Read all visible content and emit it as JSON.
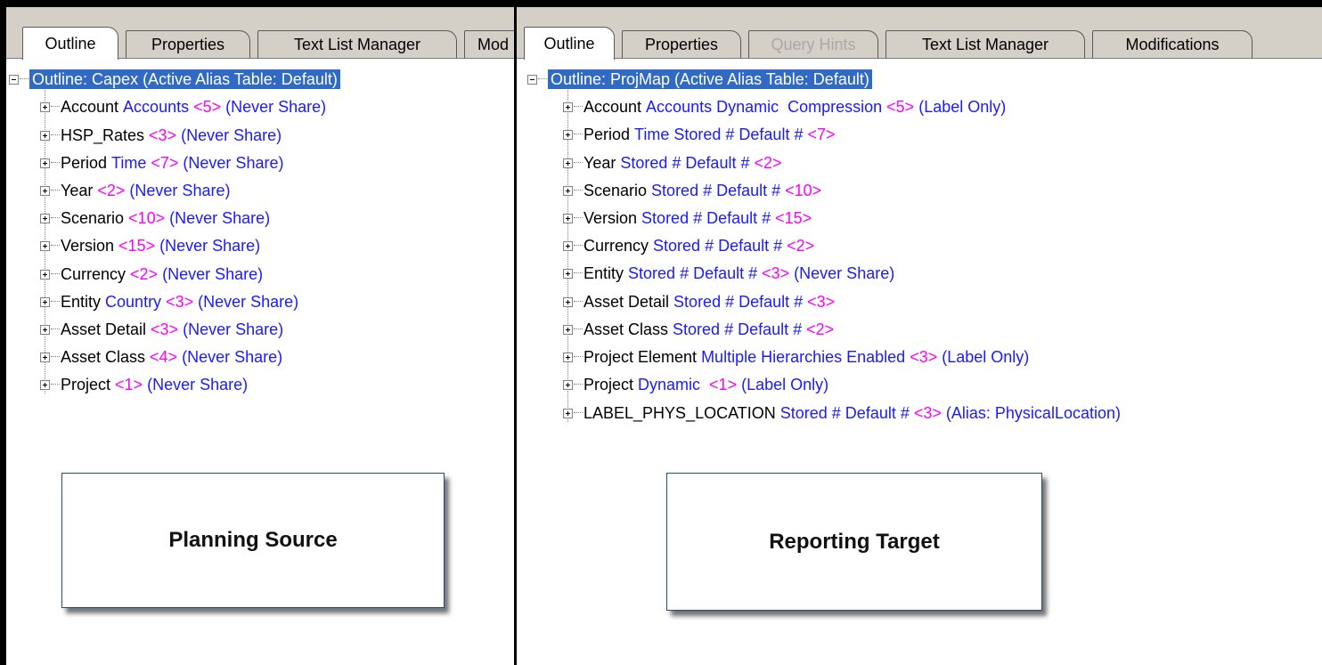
{
  "left_panel": {
    "tabs": [
      {
        "label": "Outline",
        "active": true
      },
      {
        "label": "Properties"
      },
      {
        "label": "Text List Manager"
      },
      {
        "label": "Mod"
      }
    ],
    "root": {
      "label": "Outline: Capex (Active Alias Table: Default)",
      "expander": "minus"
    },
    "members": [
      {
        "name": "Account",
        "blue": "Accounts",
        "pink": "<5>",
        "tail": "(Never Share)"
      },
      {
        "name": "HSP_Rates",
        "blue": "",
        "pink": "<3>",
        "tail": "(Never Share)"
      },
      {
        "name": "Period",
        "blue": "Time",
        "pink": "<7>",
        "tail": "(Never Share)"
      },
      {
        "name": "Year",
        "blue": "",
        "pink": "<2>",
        "tail": "(Never Share)"
      },
      {
        "name": "Scenario",
        "blue": "",
        "pink": "<10>",
        "tail": "(Never Share)"
      },
      {
        "name": "Version",
        "blue": "",
        "pink": "<15>",
        "tail": "(Never Share)"
      },
      {
        "name": "Currency",
        "blue": "",
        "pink": "<2>",
        "tail": "(Never Share)"
      },
      {
        "name": "Entity",
        "blue": "Country",
        "pink": "<3>",
        "tail": "(Never Share)"
      },
      {
        "name": "Asset Detail",
        "blue": "",
        "pink": "<3>",
        "tail": "(Never Share)"
      },
      {
        "name": "Asset Class",
        "blue": "",
        "pink": "<4>",
        "tail": "(Never Share)"
      },
      {
        "name": "Project",
        "blue": "",
        "pink": "<1>",
        "tail": "(Never Share)"
      }
    ],
    "callout": "Planning Source"
  },
  "right_panel": {
    "tabs": [
      {
        "label": "Outline",
        "active": true
      },
      {
        "label": "Properties"
      },
      {
        "label": "Query Hints",
        "disabled": true
      },
      {
        "label": "Text List Manager"
      },
      {
        "label": "Modifications"
      }
    ],
    "root": {
      "label": "Outline: ProjMap (Active Alias Table: Default)",
      "expander": "minus"
    },
    "members": [
      {
        "name": "Account",
        "blue": "Accounts Dynamic  Compression",
        "pink": "<5>",
        "tail": "(Label Only)"
      },
      {
        "name": "Period",
        "blue": "Time Stored # Default #",
        "pink": "<7>",
        "tail": ""
      },
      {
        "name": "Year",
        "blue": "Stored # Default #",
        "pink": "<2>",
        "tail": ""
      },
      {
        "name": "Scenario",
        "blue": "Stored # Default #",
        "pink": "<10>",
        "tail": ""
      },
      {
        "name": "Version",
        "blue": "Stored # Default #",
        "pink": "<15>",
        "tail": ""
      },
      {
        "name": "Currency",
        "blue": "Stored # Default #",
        "pink": "<2>",
        "tail": ""
      },
      {
        "name": "Entity",
        "blue": "Stored # Default #",
        "pink": "<3>",
        "tail": "(Never Share)"
      },
      {
        "name": "Asset Detail",
        "blue": "Stored # Default #",
        "pink": "<3>",
        "tail": ""
      },
      {
        "name": "Asset Class",
        "blue": "Stored # Default #",
        "pink": "<2>",
        "tail": ""
      },
      {
        "name": "Project Element",
        "blue": "Multiple Hierarchies Enabled",
        "pink": "<3>",
        "tail": "(Label Only)"
      },
      {
        "name": "Project",
        "blue": "Dynamic ",
        "pink": "<1>",
        "tail": "(Label Only)"
      },
      {
        "name": "LABEL_PHYS_LOCATION",
        "blue": "Stored # Default #",
        "pink": "<3>",
        "tail": "(Alias: PhysicalLocation)"
      }
    ],
    "callout": "Reporting Target"
  },
  "colors": {
    "selection": "#316ac5",
    "property_blue": "#1a1aff",
    "member_count_pink": "#ff00ff",
    "tab_face": "#d4d0c8"
  },
  "icons": {
    "root_expander": "minus-box-icon",
    "member_expander": "plus-box-icon"
  }
}
